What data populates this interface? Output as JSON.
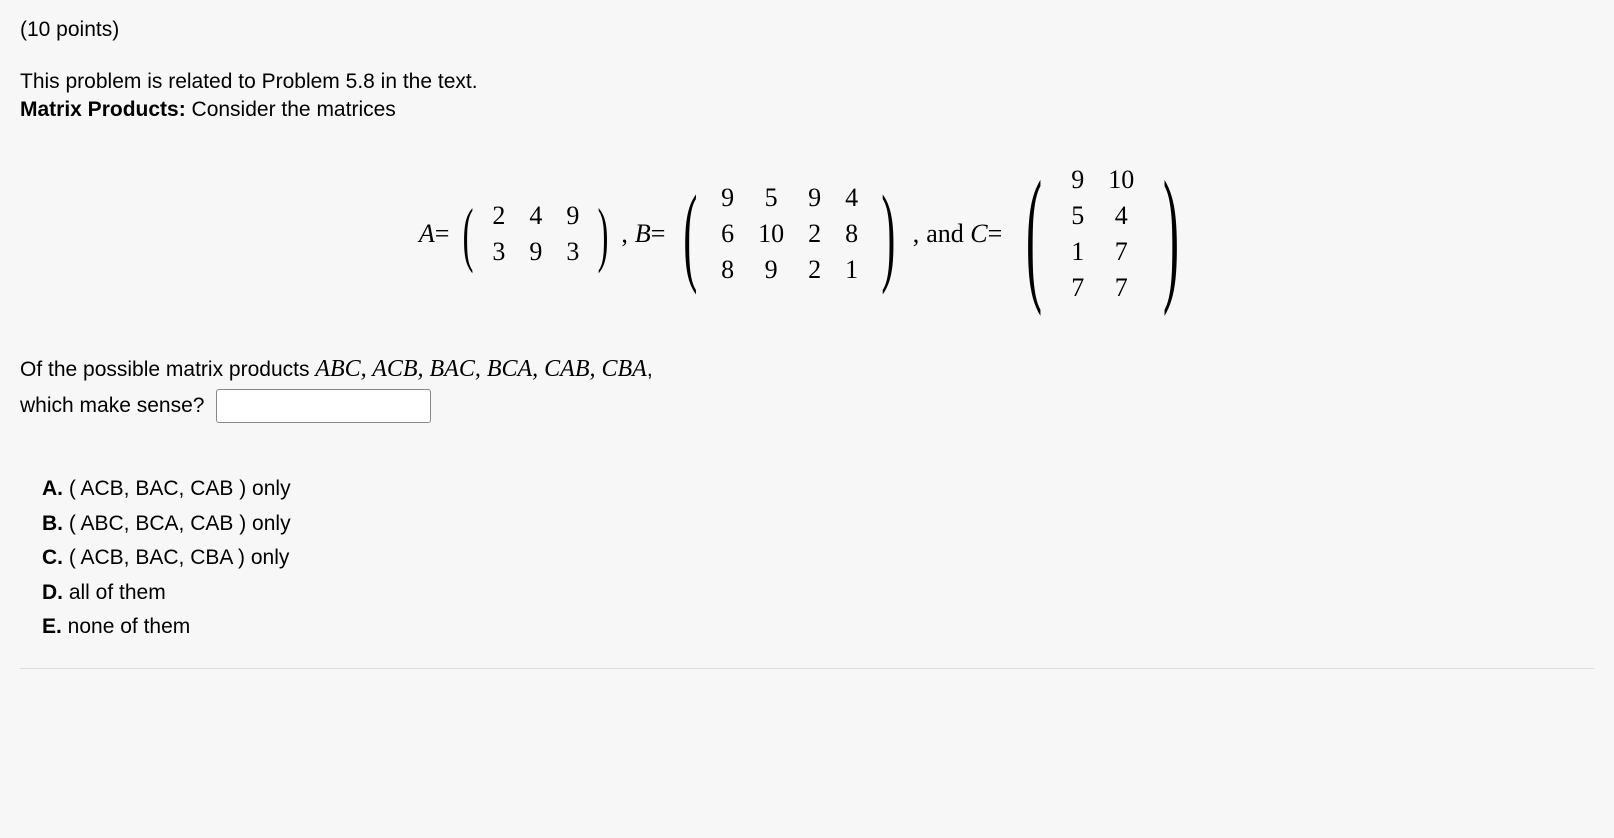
{
  "points": "(10 points)",
  "intro_line": "This problem is related to Problem 5.8 in the text.",
  "heading_bold": "Matrix Products:",
  "heading_rest": " Consider the matrices",
  "matrices": {
    "A_label": "A",
    "B_label": "B",
    "C_label": "C",
    "equals": " = ",
    "comma": ",",
    "and": "  and ",
    "A": [
      [
        2,
        4,
        9
      ],
      [
        3,
        9,
        3
      ]
    ],
    "B": [
      [
        9,
        5,
        9,
        4
      ],
      [
        6,
        10,
        2,
        8
      ],
      [
        8,
        9,
        2,
        1
      ]
    ],
    "C": [
      [
        9,
        10
      ],
      [
        5,
        4
      ],
      [
        1,
        7
      ],
      [
        7,
        7
      ]
    ]
  },
  "question": {
    "line1_prefix": "Of the possible matrix products ",
    "products": [
      "ABC",
      "ACB",
      "BAC",
      "BCA",
      "CAB",
      "CBA"
    ],
    "line1_suffix": ",",
    "line2": "which make sense?"
  },
  "options": [
    {
      "letter": "A.",
      "text": " ( ACB, BAC, CAB ) only"
    },
    {
      "letter": "B.",
      "text": " ( ABC, BCA, CAB ) only"
    },
    {
      "letter": "C.",
      "text": " ( ACB, BAC, CBA ) only"
    },
    {
      "letter": "D.",
      "text": " all of them"
    },
    {
      "letter": "E.",
      "text": " none of them"
    }
  ],
  "input_value": ""
}
